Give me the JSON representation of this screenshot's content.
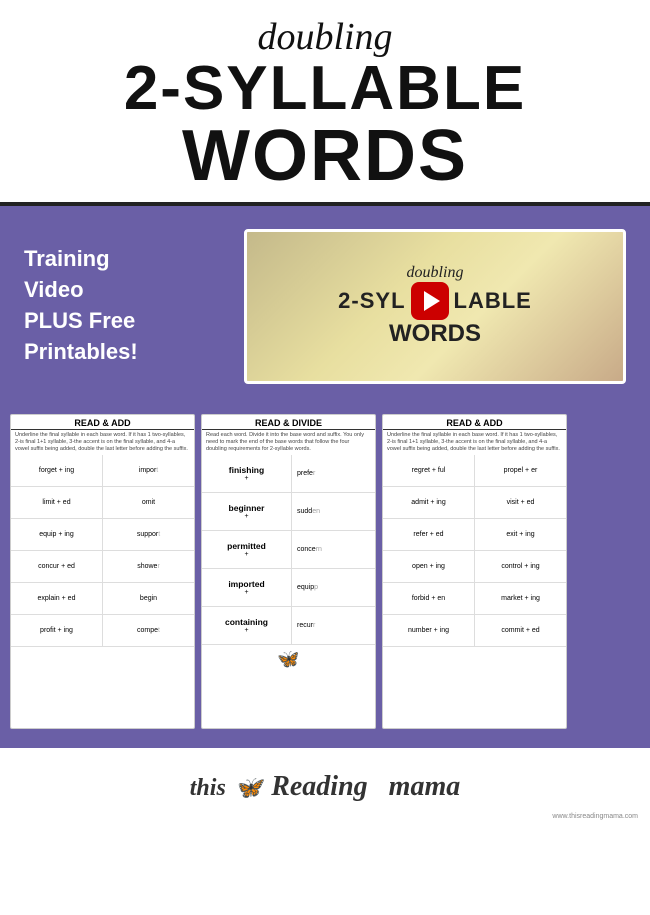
{
  "header": {
    "subtitle": "doubling",
    "title_line1": "2-SYLLABLE",
    "title_line2": "WORDS"
  },
  "mid": {
    "text_line1": "Training",
    "text_line2": "Video",
    "text_line3": "PLUS Free",
    "text_line4": "Printables!",
    "video_label1": "doubling",
    "video_label2": "2-SYL",
    "video_label3": "LABLE",
    "video_label4": "WORDS"
  },
  "worksheet_left": {
    "title": "READ & ADD",
    "rows": [
      [
        "forget + ing",
        "impor"
      ],
      [
        "limit + ed",
        "omit"
      ],
      [
        "equip + ing",
        "suppor"
      ],
      [
        "concur + ed",
        "showe"
      ],
      [
        "explain + ed",
        "begin"
      ],
      [
        "profit + ing",
        "compe"
      ]
    ]
  },
  "worksheet_mid": {
    "title": "READ & DIVIDE",
    "words": [
      "finishing",
      "beginner",
      "permitted",
      "imported",
      "containing"
    ],
    "right_words": [
      "prefe",
      "sudd",
      "conce",
      "equip",
      "recur"
    ]
  },
  "worksheet_right": {
    "title": "READ & ADD",
    "rows": [
      [
        "regret + ful",
        "propel + er"
      ],
      [
        "admit + ing",
        "visit + ed"
      ],
      [
        "refer + ed",
        "exit + ing"
      ],
      [
        "open + ing",
        "control + ing"
      ],
      [
        "forbid + en",
        "market + ing"
      ],
      [
        "number + ing",
        "commit + ed"
      ]
    ]
  },
  "footer": {
    "this": "this",
    "reading": "Reading",
    "mama": "mama",
    "website": "www.thisreadingmama.com"
  }
}
